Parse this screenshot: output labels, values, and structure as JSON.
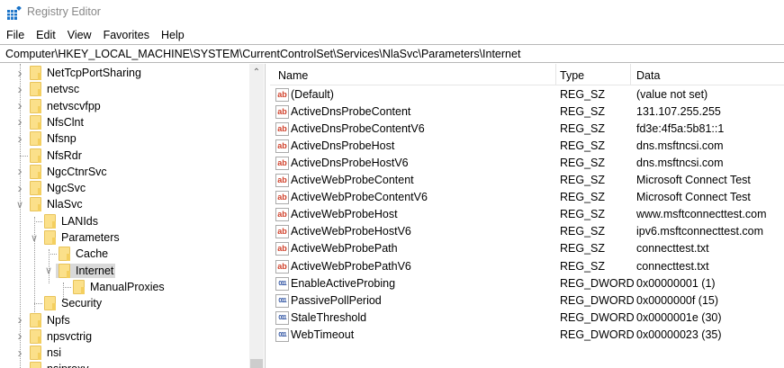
{
  "window": {
    "title": "Registry Editor",
    "icon": "registry-icon"
  },
  "menu": [
    "File",
    "Edit",
    "View",
    "Favorites",
    "Help"
  ],
  "address": "Computer\\HKEY_LOCAL_MACHINE\\SYSTEM\\CurrentControlSet\\Services\\NlaSvc\\Parameters\\Internet",
  "tree": [
    {
      "label": "NetTcpPortSharing",
      "depth": 0,
      "state": "collapsed"
    },
    {
      "label": "netvsc",
      "depth": 0,
      "state": "collapsed"
    },
    {
      "label": "netvscvfpp",
      "depth": 0,
      "state": "collapsed"
    },
    {
      "label": "NfsClnt",
      "depth": 0,
      "state": "collapsed"
    },
    {
      "label": "Nfsnp",
      "depth": 0,
      "state": "collapsed"
    },
    {
      "label": "NfsRdr",
      "depth": 0,
      "state": "leaf"
    },
    {
      "label": "NgcCtnrSvc",
      "depth": 0,
      "state": "collapsed"
    },
    {
      "label": "NgcSvc",
      "depth": 0,
      "state": "collapsed"
    },
    {
      "label": "NlaSvc",
      "depth": 0,
      "state": "expanded"
    },
    {
      "label": "LANIds",
      "depth": 1,
      "state": "leaf"
    },
    {
      "label": "Parameters",
      "depth": 1,
      "state": "expanded"
    },
    {
      "label": "Cache",
      "depth": 2,
      "state": "leaf"
    },
    {
      "label": "Internet",
      "depth": 2,
      "state": "expanded",
      "selected": true
    },
    {
      "label": "ManualProxies",
      "depth": 3,
      "state": "leaf"
    },
    {
      "label": "Security",
      "depth": 1,
      "state": "leaf"
    },
    {
      "label": "Npfs",
      "depth": 0,
      "state": "collapsed"
    },
    {
      "label": "npsvctrig",
      "depth": 0,
      "state": "collapsed"
    },
    {
      "label": "nsi",
      "depth": 0,
      "state": "collapsed"
    },
    {
      "label": "nsiproxy",
      "depth": 0,
      "state": "leaf"
    }
  ],
  "columns": {
    "name": "Name",
    "type": "Type",
    "data": "Data"
  },
  "values": [
    {
      "name": "(Default)",
      "type": "REG_SZ",
      "data": "(value not set)",
      "icon": "string-value-icon"
    },
    {
      "name": "ActiveDnsProbeContent",
      "type": "REG_SZ",
      "data": "131.107.255.255",
      "icon": "string-value-icon"
    },
    {
      "name": "ActiveDnsProbeContentV6",
      "type": "REG_SZ",
      "data": "fd3e:4f5a:5b81::1",
      "icon": "string-value-icon"
    },
    {
      "name": "ActiveDnsProbeHost",
      "type": "REG_SZ",
      "data": "dns.msftncsi.com",
      "icon": "string-value-icon"
    },
    {
      "name": "ActiveDnsProbeHostV6",
      "type": "REG_SZ",
      "data": "dns.msftncsi.com",
      "icon": "string-value-icon"
    },
    {
      "name": "ActiveWebProbeContent",
      "type": "REG_SZ",
      "data": "Microsoft Connect Test",
      "icon": "string-value-icon"
    },
    {
      "name": "ActiveWebProbeContentV6",
      "type": "REG_SZ",
      "data": "Microsoft Connect Test",
      "icon": "string-value-icon"
    },
    {
      "name": "ActiveWebProbeHost",
      "type": "REG_SZ",
      "data": "www.msftconnecttest.com",
      "icon": "string-value-icon"
    },
    {
      "name": "ActiveWebProbeHostV6",
      "type": "REG_SZ",
      "data": "ipv6.msftconnecttest.com",
      "icon": "string-value-icon"
    },
    {
      "name": "ActiveWebProbePath",
      "type": "REG_SZ",
      "data": "connecttest.txt",
      "icon": "string-value-icon"
    },
    {
      "name": "ActiveWebProbePathV6",
      "type": "REG_SZ",
      "data": "connecttest.txt",
      "icon": "string-value-icon"
    },
    {
      "name": "EnableActiveProbing",
      "type": "REG_DWORD",
      "data": "0x00000001 (1)",
      "icon": "dword-value-icon"
    },
    {
      "name": "PassivePollPeriod",
      "type": "REG_DWORD",
      "data": "0x0000000f (15)",
      "icon": "dword-value-icon"
    },
    {
      "name": "StaleThreshold",
      "type": "REG_DWORD",
      "data": "0x0000001e (30)",
      "icon": "dword-value-icon"
    },
    {
      "name": "WebTimeout",
      "type": "REG_DWORD",
      "data": "0x00000023 (35)",
      "icon": "dword-value-icon"
    }
  ]
}
